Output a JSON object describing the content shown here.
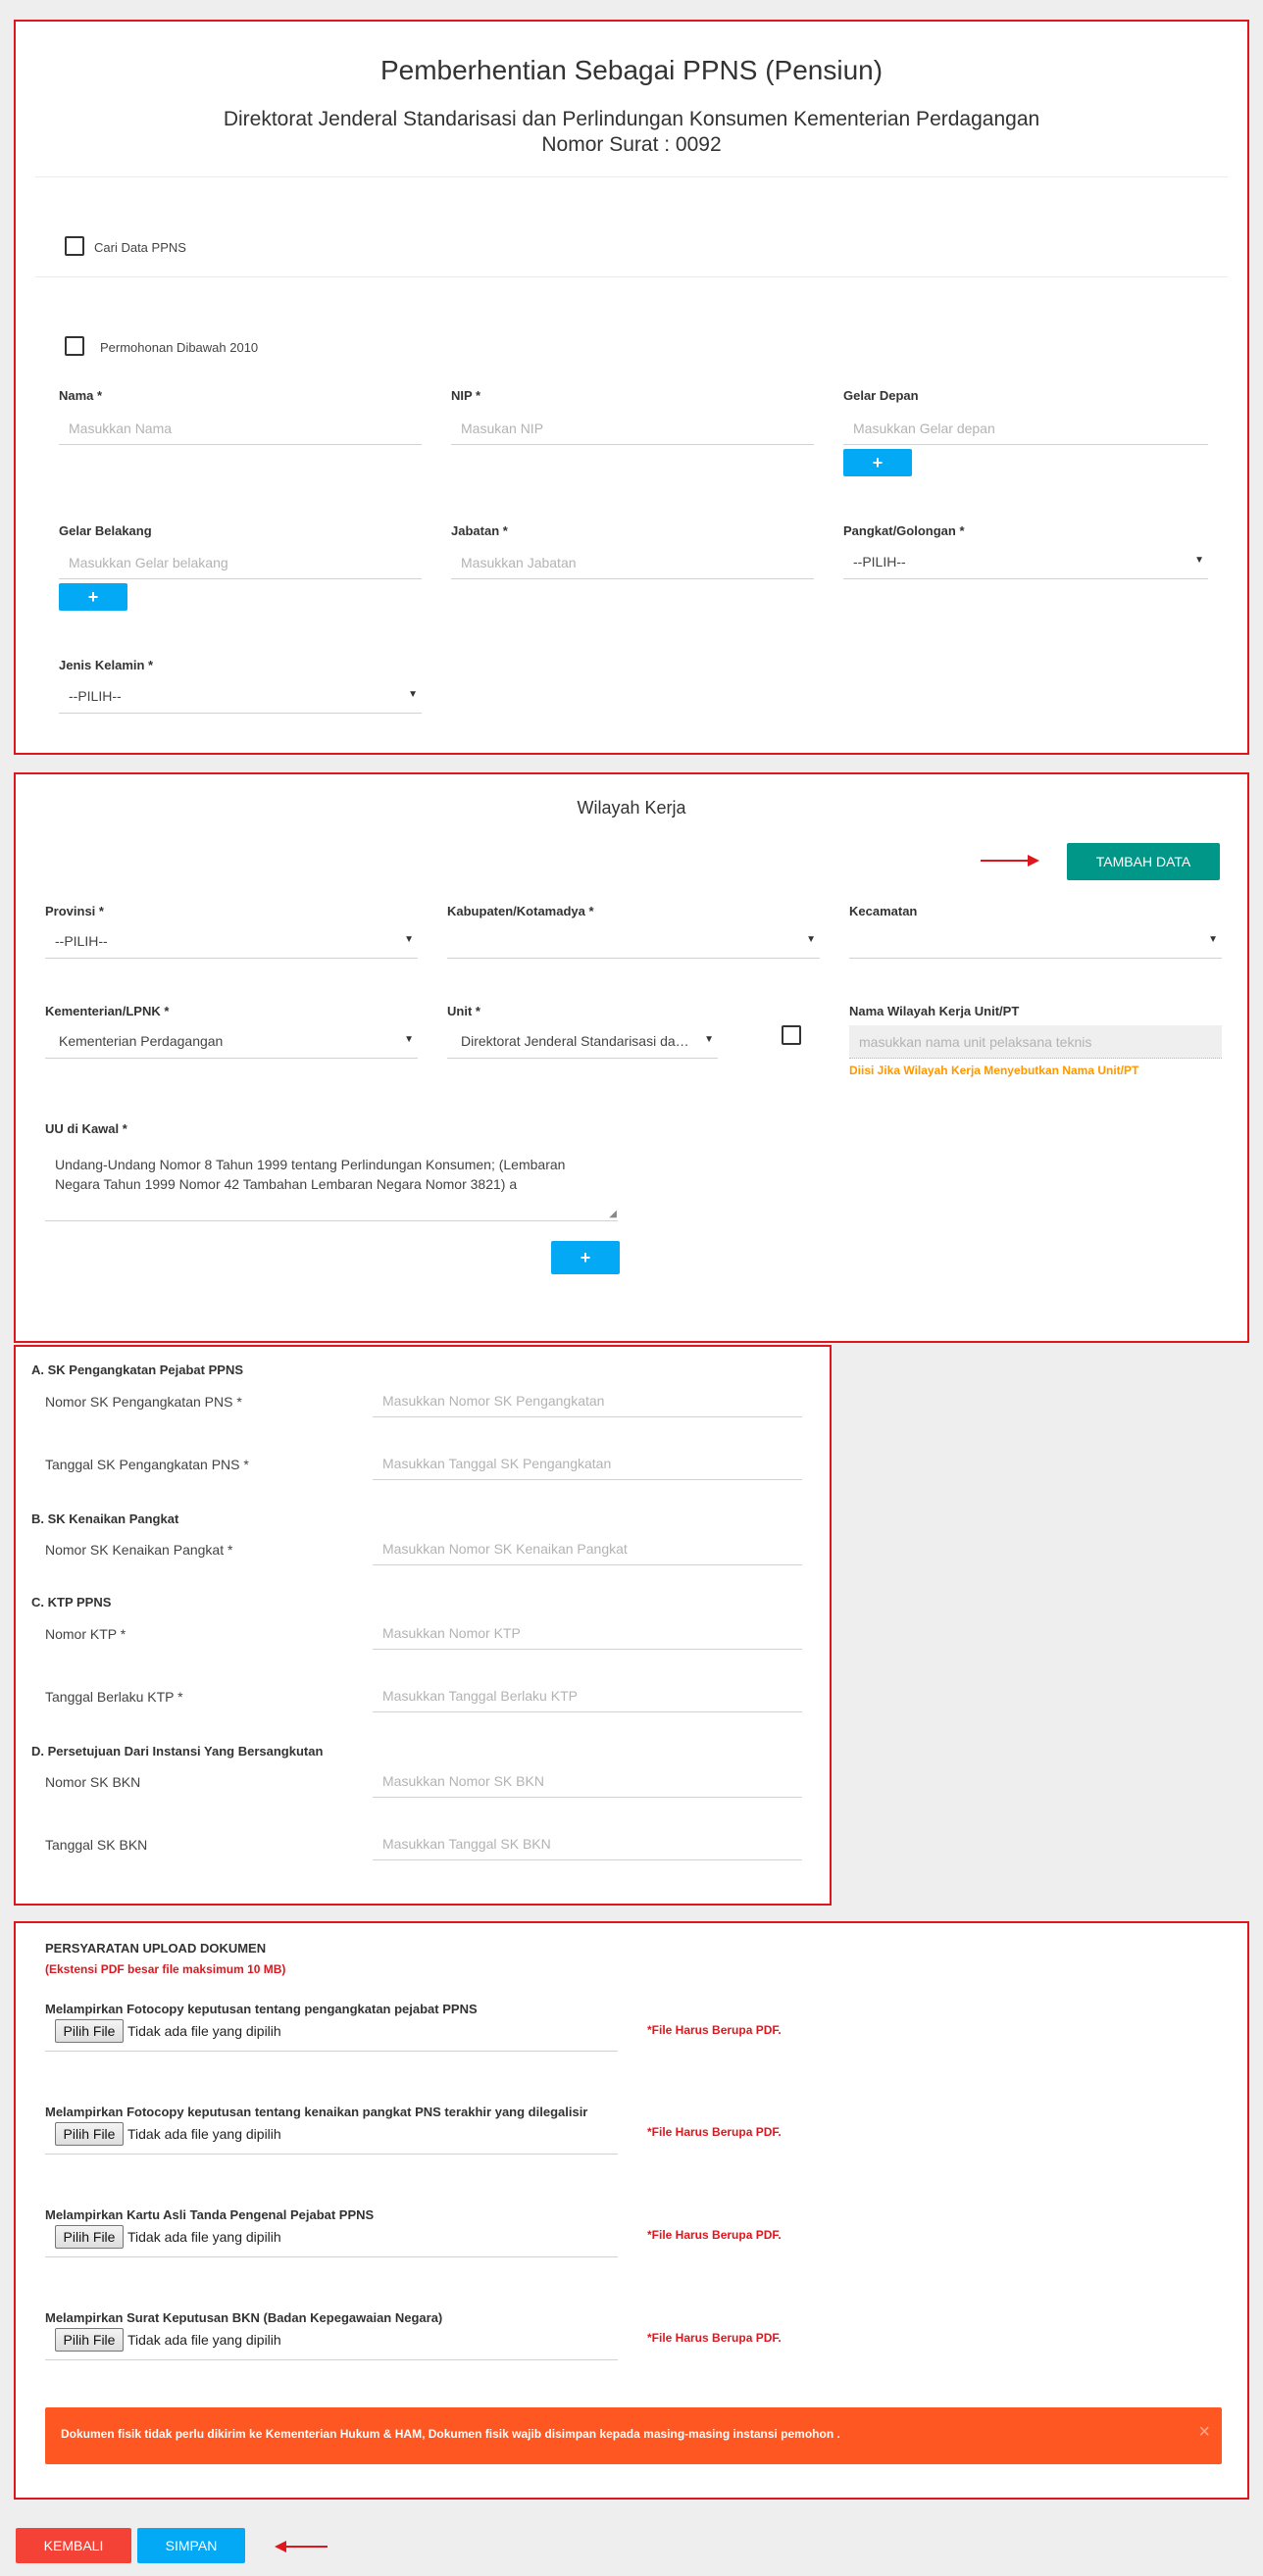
{
  "section1": {
    "title": "Pemberhentian Sebagai PPNS (Pensiun)",
    "subtitle": "Direktorat Jenderal Standarisasi dan Perlindungan Konsumen Kementerian Perdagangan",
    "nomor_surat": "Nomor Surat : 0092",
    "cari_data_label": "Cari Data PPNS",
    "permohonan_label": "Permohonan Dibawah 2010",
    "nama": {
      "label": "Nama *",
      "placeholder": "Masukkan Nama"
    },
    "nip": {
      "label": "NIP *",
      "placeholder": "Masukan NIP"
    },
    "gelar_depan": {
      "label": "Gelar Depan",
      "placeholder": "Masukkan Gelar depan"
    },
    "gelar_belakang": {
      "label": "Gelar Belakang",
      "placeholder": "Masukkan Gelar belakang"
    },
    "jabatan": {
      "label": "Jabatan *",
      "placeholder": "Masukkan Jabatan"
    },
    "pangkat": {
      "label": "Pangkat/Golongan *",
      "value": "--PILIH--"
    },
    "jenis_kelamin": {
      "label": "Jenis Kelamin *",
      "value": "--PILIH--"
    },
    "plus": "+"
  },
  "section2": {
    "title": "Wilayah Kerja",
    "tambah_data": "TAMBAH DATA",
    "provinsi": {
      "label": "Provinsi *",
      "value": "--PILIH--"
    },
    "kabupaten": {
      "label": "Kabupaten/Kotamadya *",
      "value": ""
    },
    "kecamatan": {
      "label": "Kecamatan",
      "value": ""
    },
    "kementerian": {
      "label": "Kementerian/LPNK *",
      "value": "Kementerian Perdagangan"
    },
    "unit": {
      "label": "Unit *",
      "value": "Direktorat Jenderal Standarisasi dan Perlindungan Konsumen"
    },
    "nama_wilayah": {
      "label": "Nama Wilayah Kerja Unit/PT",
      "placeholder": "masukkan nama unit pelaksana teknis",
      "note": "Diisi Jika Wilayah Kerja Menyebutkan Nama Unit/PT"
    },
    "uu": {
      "label": "UU di Kawal *",
      "value": "Undang-Undang Nomor 8 Tahun 1999 tentang Perlindungan Konsumen; (Lembaran Negara Tahun 1999 Nomor 42 Tambahan Lembaran Negara Nomor 3821) a"
    },
    "plus": "+"
  },
  "section3": {
    "a_title": "A. SK Pengangkatan Pejabat PPNS",
    "nomor_sk_pengangkatan": {
      "label": "Nomor SK Pengangkatan PNS *",
      "placeholder": "Masukkan Nomor SK Pengangkatan"
    },
    "tanggal_sk_pengangkatan": {
      "label": "Tanggal SK Pengangkatan PNS *",
      "placeholder": "Masukkan Tanggal SK Pengangkatan"
    },
    "b_title": "B. SK Kenaikan Pangkat",
    "nomor_sk_kenaikan": {
      "label": "Nomor SK Kenaikan Pangkat *",
      "placeholder": "Masukkan Nomor SK Kenaikan Pangkat"
    },
    "c_title": "C. KTP PPNS",
    "nomor_ktp": {
      "label": "Nomor KTP *",
      "placeholder": "Masukkan Nomor KTP"
    },
    "tanggal_ktp": {
      "label": "Tanggal Berlaku KTP *",
      "placeholder": "Masukkan Tanggal Berlaku KTP"
    },
    "d_title": "D. Persetujuan Dari Instansi Yang Bersangkutan",
    "nomor_bkn": {
      "label": "Nomor SK BKN",
      "placeholder": "Masukkan Nomor SK BKN"
    },
    "tanggal_bkn": {
      "label": "Tanggal SK BKN",
      "placeholder": "Masukkan Tanggal SK BKN"
    }
  },
  "section4": {
    "title": "PERSYARATAN UPLOAD DOKUMEN",
    "subtitle": "(Ekstensi PDF besar file maksimum 10 MB)",
    "button_label": "Pilih File",
    "no_file": "Tidak ada file yang dipilih",
    "pdf_note": "*File Harus Berupa PDF.",
    "files": [
      {
        "label": "Melampirkan Fotocopy keputusan tentang pengangkatan pejabat PPNS"
      },
      {
        "label": "Melampirkan Fotocopy keputusan tentang kenaikan pangkat PNS terakhir yang dilegalisir"
      },
      {
        "label": "Melampirkan Kartu Asli Tanda Pengenal Pejabat PPNS"
      },
      {
        "label": "Melampirkan Surat Keputusan BKN (Badan Kepegawaian Negara)"
      }
    ],
    "alert": "Dokumen fisik tidak perlu dikirim ke Kementerian Hukum & HAM, Dokumen fisik wajib disimpan kepada masing-masing instansi pemohon .",
    "alert_close": "×"
  },
  "footer": {
    "kembali": "KEMBALI",
    "simpan": "SIMPAN"
  },
  "colors": {
    "panel_border": "#e0161e",
    "teal": "#009688",
    "blue": "#03a9f4",
    "orange_alert": "#ff5722",
    "red_button": "#f44336",
    "warning_note": "#ff9800"
  }
}
